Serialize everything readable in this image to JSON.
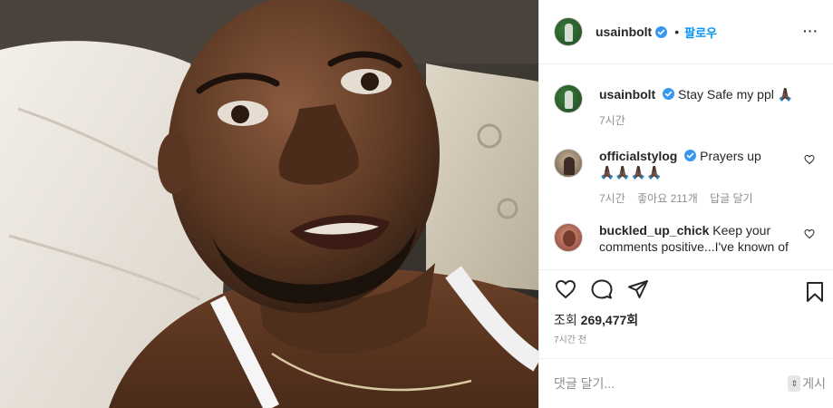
{
  "post": {
    "author": "usainbolt",
    "follow_separator": "•",
    "follow_label": "팔로우",
    "more_label": "···",
    "caption": "Stay Safe my ppl",
    "caption_emoji": "🙏🏿",
    "caption_time": "7시간"
  },
  "comments": [
    {
      "user": "officialstylog",
      "text": "Prayers up",
      "emoji": "🙏🏿🙏🏿🙏🏿🙏🏿",
      "time": "7시간",
      "likes": "좋아요 211개",
      "reply": "답글 달기"
    },
    {
      "user": "buckled_up_chick",
      "text": "Keep your comments positive...I've known of",
      "time": "",
      "likes": "",
      "reply": ""
    }
  ],
  "stats": {
    "views_label": "조회",
    "views_count": "269,477회",
    "posted_ago": "7시간 전"
  },
  "composer": {
    "placeholder": "댓글 달기...",
    "post_label": "게시",
    "key_hint": "⇕"
  },
  "icons": {
    "verified": "verified-badge-icon",
    "like": "heart-icon",
    "comment": "comment-icon",
    "share": "share-icon",
    "save": "bookmark-icon"
  },
  "colors": {
    "link_blue": "#0095f6",
    "verified_blue": "#3897f0",
    "muted": "#8e8e8e",
    "text": "#262626"
  }
}
